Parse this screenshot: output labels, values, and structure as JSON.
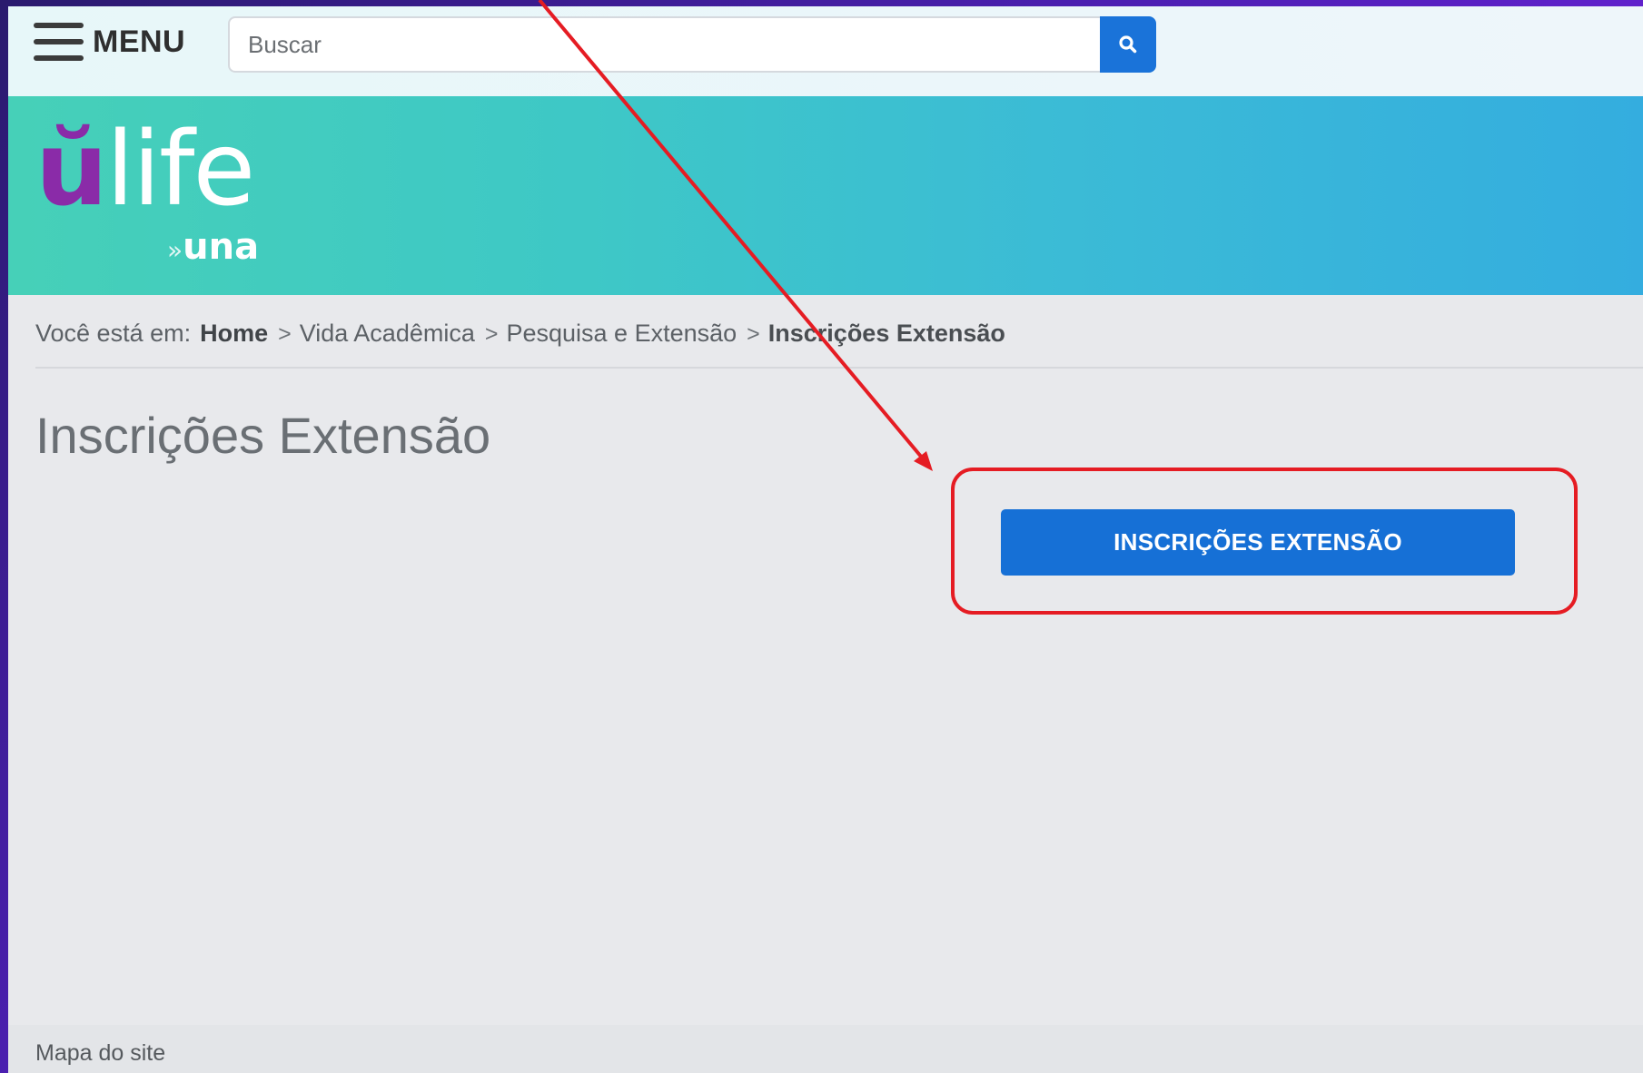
{
  "header": {
    "menu_label": "MENU",
    "search_placeholder": "Buscar"
  },
  "logo": {
    "letter": "ŭ",
    "word": "life",
    "sub": "una",
    "sub_prefix": "»"
  },
  "breadcrumb": {
    "prefix": "Você está em:",
    "separator": ">",
    "items": [
      "Home",
      "Vida Acadêmica",
      "Pesquisa e Extensão",
      "Inscrições Extensão"
    ]
  },
  "main": {
    "title": "Inscrições Extensão",
    "cta_label": "INSCRIÇÕES EXTENSÃO"
  },
  "footer": {
    "sitemap_label": "Mapa do site"
  },
  "colors": {
    "accent_blue": "#1670d6",
    "annotation_red": "#e51c23",
    "logo_purple": "#8a2ba8"
  }
}
